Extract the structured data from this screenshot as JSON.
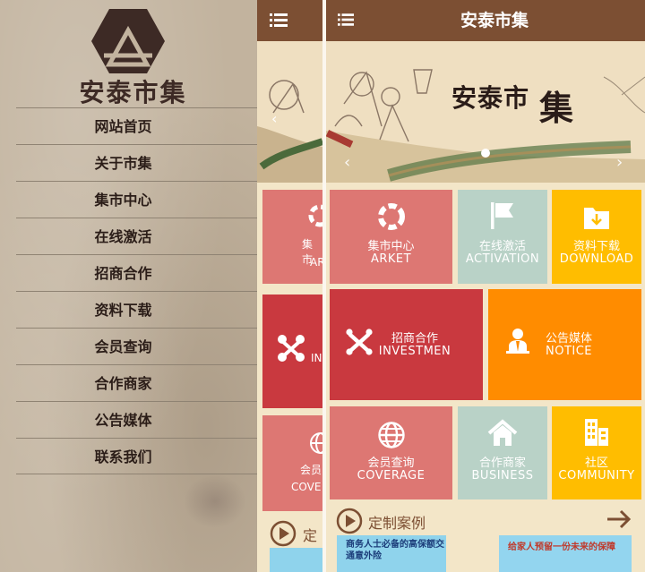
{
  "drawer": {
    "logo_text": "安泰市集",
    "menu": [
      {
        "label": "网站首页"
      },
      {
        "label": "关于市集"
      },
      {
        "label": "集市中心"
      },
      {
        "label": "在线激活"
      },
      {
        "label": "招商合作"
      },
      {
        "label": "资料下载"
      },
      {
        "label": "会员查询"
      },
      {
        "label": "合作商家"
      },
      {
        "label": "公告媒体"
      },
      {
        "label": "联系我们"
      }
    ]
  },
  "strip": {
    "tiles": [
      {
        "cn": "集市",
        "en": "ARI"
      },
      {
        "cn": "",
        "en": "IN"
      },
      {
        "cn": "会员",
        "en": "COVE"
      }
    ],
    "case_partial": "定"
  },
  "header": {
    "title": "安泰市集",
    "menu_icon": "list-menu-icon"
  },
  "banner": {
    "title": "安泰市",
    "title_char": "集"
  },
  "tiles": [
    {
      "cn": "集市中心",
      "en": "ARKET",
      "icon": "market-ring-icon",
      "color": "#dd7773"
    },
    {
      "cn": "在线激活",
      "en": "ACTIVATION",
      "icon": "flag-icon",
      "color": "#b9d2c7"
    },
    {
      "cn": "资料下载",
      "en": "DOWNLOAD",
      "icon": "download-icon",
      "color": "#ffbd00"
    },
    {
      "cn": "招商合作",
      "en": "INVESTMEN",
      "icon": "joomla-icon",
      "color": "#c9393f"
    },
    {
      "cn": "公告媒体",
      "en": "NOTICE",
      "icon": "person-icon",
      "color": "#ff8c00"
    },
    {
      "cn": "会员查询",
      "en": "COVERAGE",
      "icon": "globe-icon",
      "color": "#dd7773"
    },
    {
      "cn": "合作商家",
      "en": "BUSINESS",
      "icon": "home-icon",
      "color": "#b9d2c7"
    },
    {
      "cn": "社区",
      "en": "COMMUNITY",
      "icon": "building-icon",
      "color": "#ffbd00"
    }
  ],
  "cases": {
    "title": "定制案例",
    "cards": [
      {
        "text": "商务人士必备的高保额交通意外险"
      },
      {
        "text": "给家人预留一份未来的保障"
      }
    ]
  },
  "colors": {
    "header": "#7c4f33",
    "page_bg": "#f3e6c8",
    "drawer_bg": "#c2b39e"
  }
}
